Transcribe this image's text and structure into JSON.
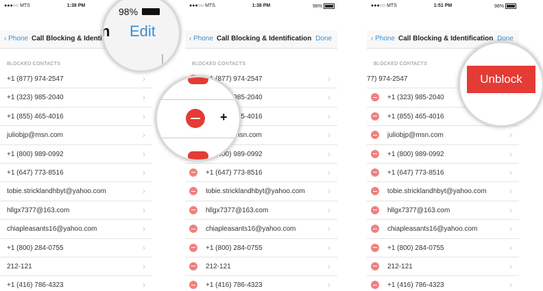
{
  "screens": [
    {
      "status": {
        "carrier": "●●●○○ MTS",
        "time": "1:38 PM",
        "battery": ""
      },
      "nav": {
        "back": "Phone",
        "title": "Call Blocking & Identif",
        "action": ""
      },
      "section": "BLOCKED CONTACTS",
      "contacts": [
        "+1 (877) 974-2547",
        "+1 (323) 985-2040",
        "+1 (855) 465-4016",
        "juliobjp@msn.com",
        "+1 (800) 989-0992",
        "+1 (647) 773-8516",
        "tobie.stricklandhbyt@yahoo.com",
        "hllgx7377@163.com",
        "chiapleasants16@yahoo.com",
        "+1 (800) 284-0755",
        "212-121",
        "+1 (416) 786-4323"
      ]
    },
    {
      "status": {
        "carrier": "●●●○○ MTS",
        "time": "1:38 PM",
        "battery": "98%"
      },
      "nav": {
        "back": "Phone",
        "title": "Call Blocking & Identification",
        "action": "Done"
      },
      "section": "BLOCKED CONTACTS",
      "contacts": [
        "+1 (877) 974-2547",
        "+1 (323) 985-2040",
        "+1 (855) 465-4016",
        "juliobjp@msn.com",
        "+1 (800) 989-0992",
        "+1 (647) 773-8516",
        "tobie.stricklandhbyt@yahoo.com",
        "hllgx7377@163.com",
        "chiapleasants16@yahoo.com",
        "+1 (800) 284-0755",
        "212-121",
        "+1 (416) 786-4323"
      ]
    },
    {
      "status": {
        "carrier": "●●●○○ MTS",
        "time": "1:51 PM",
        "battery": "98%"
      },
      "nav": {
        "back": "Phone",
        "title": "Call Blocking & Identification",
        "action": "Done"
      },
      "section": "BLOCKED CONTACTS",
      "first_partial": "77) 974-2547",
      "contacts": [
        "+1 (323) 985-2040",
        "+1 (855) 465-4016",
        "juliobjp@msn.com",
        "+1 (800) 989-0992",
        "+1 (647) 773-8516",
        "tobie.stricklandhbyt@yahoo.com",
        "hllgx7377@163.com",
        "chiapleasants16@yahoo.com",
        "+1 (800) 284-0755",
        "212-121",
        "+1 (416) 786-4323"
      ]
    }
  ],
  "magnifiers": {
    "m1": {
      "battery_pct": "98%",
      "title_end": "n",
      "edit": "Edit"
    },
    "m2": {
      "plus": "+"
    },
    "m3": {
      "unblock": "Unblock"
    }
  },
  "colors": {
    "accent": "#3b8dd4",
    "destructive": "#e43b35"
  }
}
